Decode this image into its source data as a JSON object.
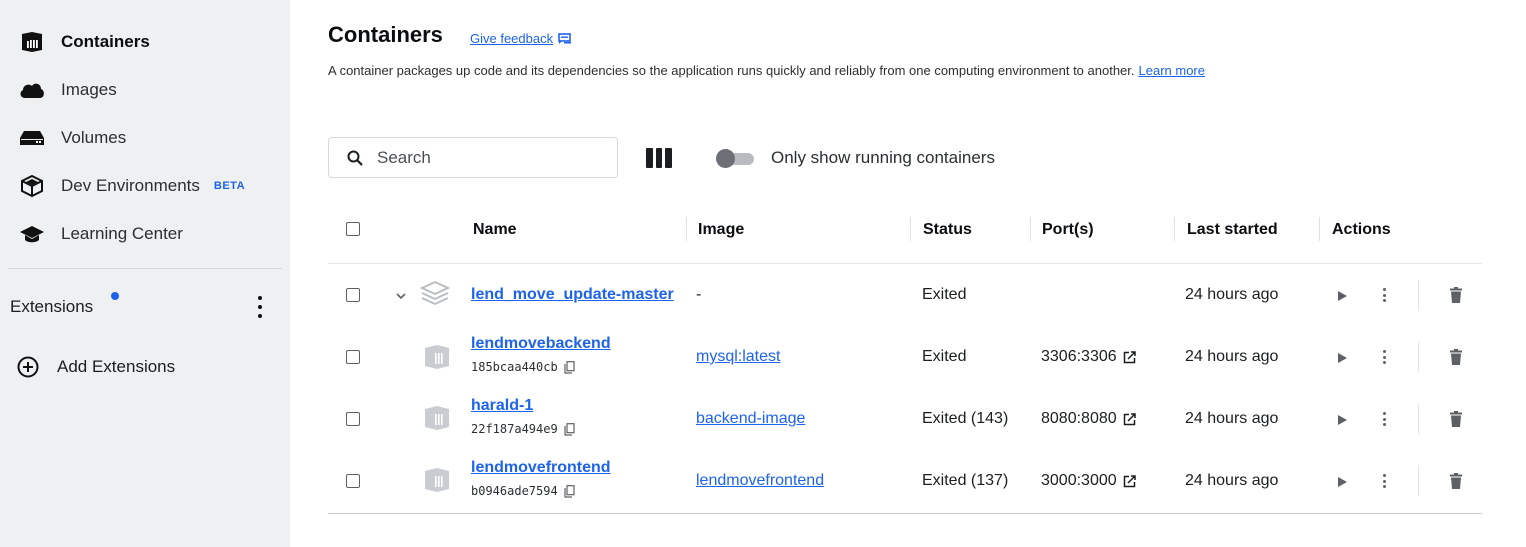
{
  "sidebar": {
    "items": [
      {
        "label": "Containers",
        "icon": "containers-icon",
        "active": true
      },
      {
        "label": "Images",
        "icon": "cloud-icon",
        "active": false
      },
      {
        "label": "Volumes",
        "icon": "drive-icon",
        "active": false
      },
      {
        "label": "Dev Environments",
        "icon": "cube-icon",
        "active": false,
        "badge": "BETA"
      },
      {
        "label": "Learning Center",
        "icon": "graduation-cap-icon",
        "active": false
      }
    ],
    "extensions_label": "Extensions",
    "add_extensions_label": "Add Extensions"
  },
  "header": {
    "title": "Containers",
    "feedback_label": "Give feedback",
    "description": "A container packages up code and its dependencies so the application runs quickly and reliably from one computing environment to another.",
    "learn_more_label": "Learn more"
  },
  "toolbar": {
    "search_placeholder": "Search",
    "toggle_label": "Only show running containers",
    "toggle_on": false
  },
  "table": {
    "columns": {
      "name": "Name",
      "image": "Image",
      "status": "Status",
      "ports": "Port(s)",
      "last_started": "Last started",
      "actions": "Actions"
    },
    "rows": [
      {
        "name": "lend_move_update-master",
        "id": "",
        "image": "-",
        "image_is_link": false,
        "status": "Exited",
        "ports": "",
        "last_started": "24 hours ago",
        "type": "compose-group"
      },
      {
        "name": "lendmovebackend",
        "id": "185bcaa440cb",
        "image": "mysql:latest",
        "image_is_link": true,
        "status": "Exited",
        "ports": "3306:3306",
        "last_started": "24 hours ago",
        "type": "container"
      },
      {
        "name": "harald-1",
        "id": "22f187a494e9",
        "image": "backend-image",
        "image_is_link": true,
        "status": "Exited (143)",
        "ports": "8080:8080",
        "last_started": "24 hours ago",
        "type": "container"
      },
      {
        "name": "lendmovefrontend",
        "id": "b0946ade7594",
        "image": "lendmovefrontend",
        "image_is_link": true,
        "status": "Exited (137)",
        "ports": "3000:3000",
        "last_started": "24 hours ago",
        "type": "container"
      }
    ]
  },
  "colors": {
    "accent": "#1d63ed",
    "sidebar_bg": "#eef0f2",
    "text": "#1b1e21"
  }
}
